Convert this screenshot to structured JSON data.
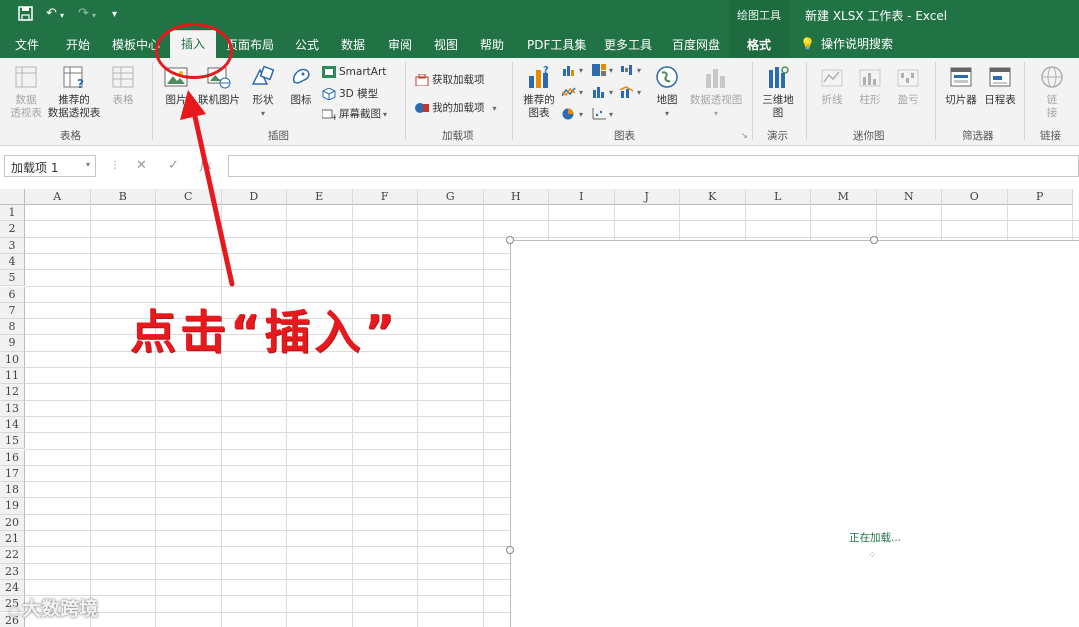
{
  "titlebar": {
    "tools_label": "绘图工具",
    "doc_title": "新建 XLSX 工作表  -  Excel"
  },
  "tabs": {
    "file": "文件",
    "home": "开始",
    "template": "模板中心",
    "insert": "插入",
    "layout": "页面布局",
    "formula": "公式",
    "data": "数据",
    "review": "审阅",
    "view": "视图",
    "help": "帮助",
    "pdf": "PDF工具集",
    "more": "更多工具",
    "baidu": "百度网盘",
    "format": "格式",
    "tell_me": "操作说明搜索"
  },
  "ribbon": {
    "table_group": {
      "label": "表格",
      "pivot": "数据\n透视表",
      "recommended_pivot": "推荐的\n数据透视表",
      "table": "表格"
    },
    "illustrations_group": {
      "label": "插图",
      "pictures": "图片",
      "online_pictures": "联机图片",
      "shapes": "形状",
      "icons": "图标",
      "smartart": "SmartArt",
      "model3d": "3D 模型",
      "screenshot": "屏幕截图"
    },
    "addins_group": {
      "label": "加载项",
      "get_addins": "获取加载项",
      "my_addins": "我的加载项"
    },
    "charts_group": {
      "label": "图表",
      "recommended": "推荐的\n图表",
      "map": "地图",
      "pivot_chart": "数据透视图"
    },
    "tours_group": {
      "label": "演示",
      "map3d": "三维地\n图"
    },
    "sparklines_group": {
      "label": "迷你图",
      "line": "折线",
      "column": "柱形",
      "winloss": "盈亏"
    },
    "filters_group": {
      "label": "筛选器",
      "slicer": "切片器",
      "timeline": "日程表"
    },
    "links_group": {
      "label": "链接",
      "link": "链\n接"
    }
  },
  "formula_bar": {
    "name_box": "加载项 1",
    "cancel": "✕",
    "enter": "✓",
    "fx": "fx",
    "value": ""
  },
  "columns": [
    "A",
    "B",
    "C",
    "D",
    "E",
    "F",
    "G",
    "H",
    "I",
    "J",
    "K",
    "L",
    "M",
    "N",
    "O",
    "P"
  ],
  "rows": [
    "1",
    "2",
    "3",
    "4",
    "5",
    "6",
    "7",
    "8",
    "9",
    "10",
    "11",
    "12",
    "13",
    "14",
    "15",
    "16",
    "17",
    "18",
    "19",
    "20",
    "21",
    "22",
    "23",
    "24",
    "25",
    "26"
  ],
  "picture": {
    "loading_text": "正在加载..."
  },
  "annotation": {
    "text": "点击“插入”",
    "arrow_color": "#e8191c"
  },
  "watermark": {
    "text": "大数跨境"
  },
  "colors": {
    "excel_green": "#217346",
    "annotation_red": "#e8191c"
  }
}
